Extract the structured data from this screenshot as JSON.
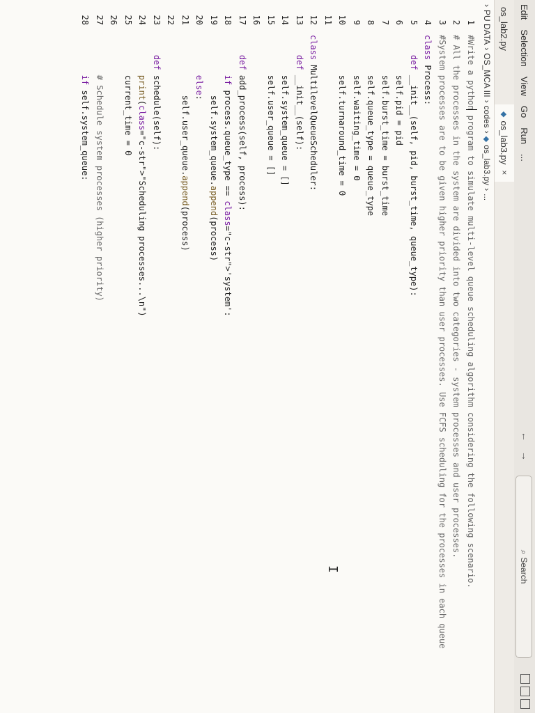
{
  "menu": [
    "Edit",
    "Selection",
    "View",
    "Go",
    "Run",
    "..."
  ],
  "nav": {
    "back": "←",
    "forward": "→"
  },
  "search": {
    "label": "Search"
  },
  "tabs": [
    {
      "label": "os_lab2.py",
      "active": false
    },
    {
      "label": "os_lab3.py",
      "active": true,
      "close": "×"
    }
  ],
  "breadcrumb": [
    "PU DATA",
    "OS_MCA III",
    "codes",
    "os_lab3.py",
    "..."
  ],
  "lines": [
    {
      "n": "1",
      "text": "#Write a python program to simulate multi-level queue scheduling algorithm considering the following scenario."
    },
    {
      "n": "2",
      "text": "# All the processes in the system are divided into two categories - system processes and user processes."
    },
    {
      "n": "3",
      "text": "#System processes are to be given higher priority than user processes. Use FCFS scheduling for the processes in each queue"
    },
    {
      "n": "4",
      "text": "class Process:"
    },
    {
      "n": "5",
      "text": "    def __init__(self, pid, burst_time, queue_type):"
    },
    {
      "n": "6",
      "text": "        self.pid = pid"
    },
    {
      "n": "7",
      "text": "        self.burst_time = burst_time"
    },
    {
      "n": "8",
      "text": "        self.queue_type = queue_type"
    },
    {
      "n": "9",
      "text": "        self.waiting_time = 0"
    },
    {
      "n": "10",
      "text": "        self.turnaround_time = 0"
    },
    {
      "n": "11",
      "text": ""
    },
    {
      "n": "12",
      "text": "class MultilevelQueueScheduler:"
    },
    {
      "n": "13",
      "text": "    def __init__(self):"
    },
    {
      "n": "14",
      "text": "        self.system_queue = []"
    },
    {
      "n": "15",
      "text": "        self.user_queue = []"
    },
    {
      "n": "16",
      "text": ""
    },
    {
      "n": "17",
      "text": "    def add_process(self, process):"
    },
    {
      "n": "18",
      "text": "        if process.queue_type == 'system':"
    },
    {
      "n": "19",
      "text": "            self.system_queue.append(process)"
    },
    {
      "n": "20",
      "text": "        else:"
    },
    {
      "n": "21",
      "text": "            self.user_queue.append(process)"
    },
    {
      "n": "22",
      "text": ""
    },
    {
      "n": "23",
      "text": "    def schedule(self):"
    },
    {
      "n": "24",
      "text": "        print(\"Scheduling processes...\\n\")"
    },
    {
      "n": "25",
      "text": "        current_time = 0"
    },
    {
      "n": "26",
      "text": ""
    },
    {
      "n": "27",
      "text": "        # Schedule system processes (higher priority)"
    },
    {
      "n": "28",
      "text": "        if self.system_queue:"
    }
  ],
  "colors": {
    "keyword": "#7a1fa2",
    "function": "#795e26",
    "string": "#a31515",
    "comment": "#6a6a6a"
  }
}
